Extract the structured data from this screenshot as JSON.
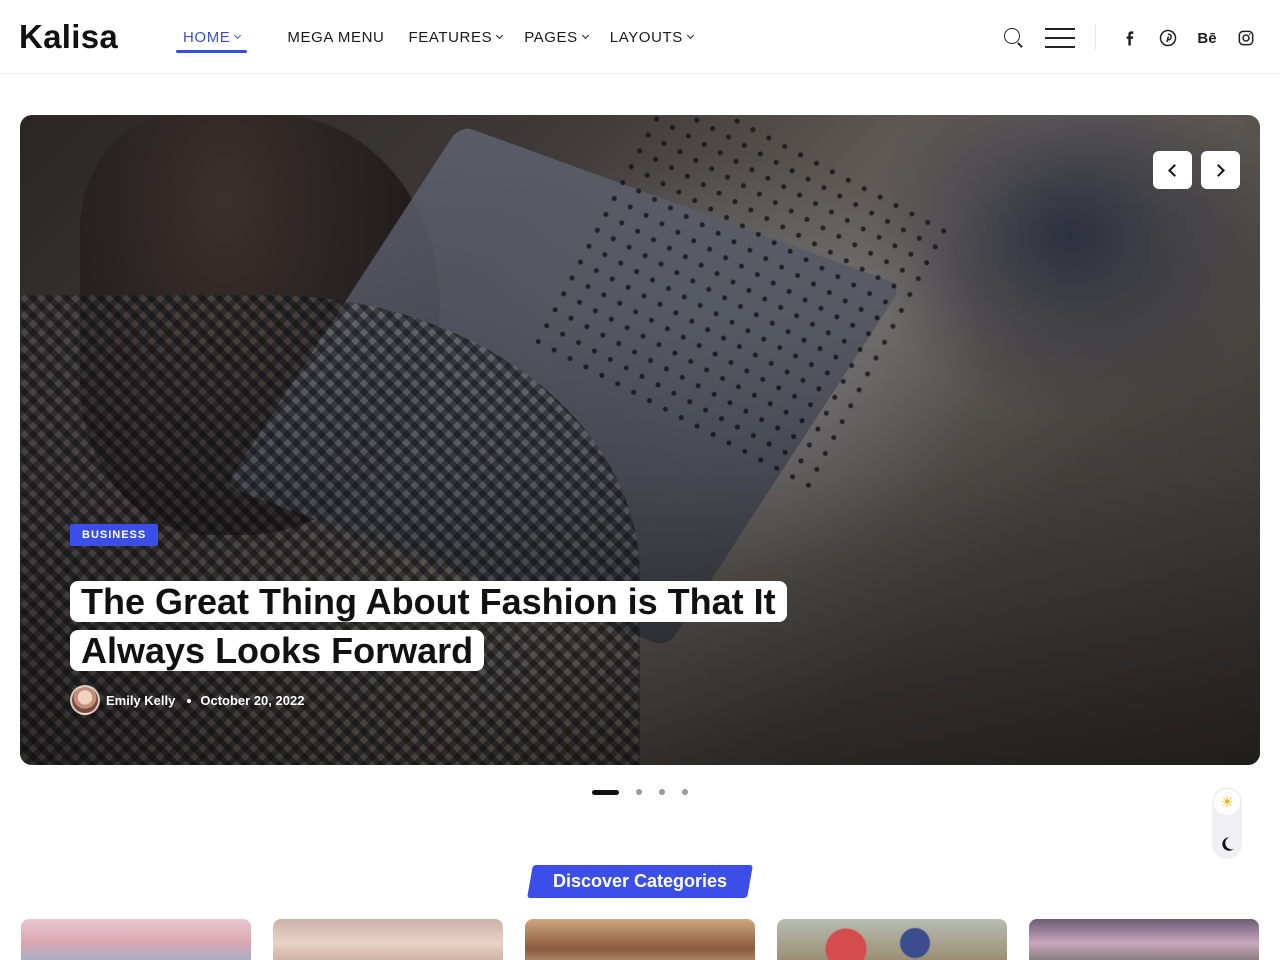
{
  "header": {
    "logo": "Kalisa",
    "nav": [
      {
        "label": "HOME",
        "active": true,
        "dropdown": true
      },
      {
        "label": "MEGA MENU",
        "active": false,
        "dropdown": false
      },
      {
        "label": "FEATURES",
        "active": false,
        "dropdown": true
      },
      {
        "label": "PAGES",
        "active": false,
        "dropdown": true
      },
      {
        "label": "LAYOUTS",
        "active": false,
        "dropdown": true
      }
    ],
    "social": [
      "facebook-icon",
      "pinterest-icon",
      "behance-icon",
      "instagram-icon"
    ],
    "behance_label": "Bē"
  },
  "hero": {
    "category": "BUSINESS",
    "title_line1": "The Great Thing About Fashion is That It",
    "title_line2": "Always Looks Forward",
    "author": "Emily Kelly",
    "date": "October 20, 2022",
    "slides_total": 4,
    "slide_active": 1
  },
  "theme": {
    "sun_glyph": "☀"
  },
  "discover": {
    "title": "Discover Categories"
  },
  "colors": {
    "accent": "#3b4ee8",
    "nav_active": "#3a4fd6"
  }
}
